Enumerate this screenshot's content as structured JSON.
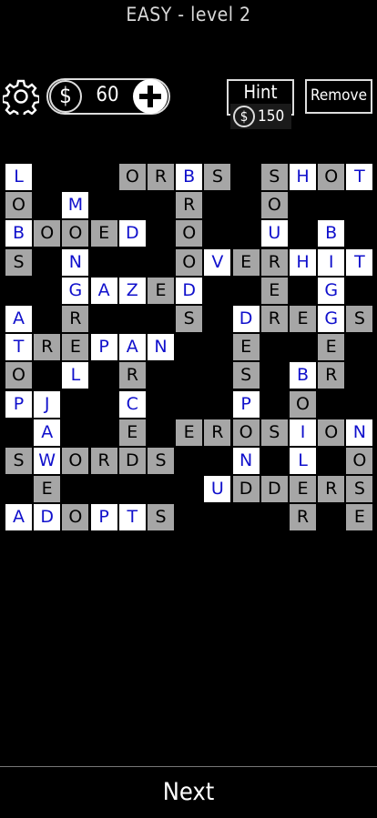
{
  "header": {
    "title": "EASY - level 2"
  },
  "toolbar": {
    "coin_symbol": "$",
    "coins": "60",
    "hint_label": "Hint",
    "hint_cost": "150",
    "remove_label": "Remove"
  },
  "footer": {
    "next_label": "Next"
  },
  "board": {
    "rows": [
      "LTTTOTRBSTTSHOT",
      "OTMTTTRTTTOTTTT",
      "BOOEDTTOTTUTTBT",
      "STNTTTTOVERHIT ",
      "TTGAZEDTTTETGTT",
      "ATRTTTSTTDREGS ",
      "TREPANTTTETTET ",
      "OTLTRTTTTSTBRTT",
      "PJTTCTTTTPTOTTT",
      "TATTETEROSION  ",
      "SWORDSTTTNTLTO ",
      "TETTTTTTUDDERS ",
      "ADOPTSTTTTTRTE "
    ],
    "cells": [
      {
        "r": 0,
        "c": 0,
        "ch": "L",
        "style": "w"
      },
      {
        "r": 0,
        "c": 4,
        "ch": "O",
        "style": "g"
      },
      {
        "r": 0,
        "c": 5,
        "ch": "R",
        "style": "g"
      },
      {
        "r": 0,
        "c": 6,
        "ch": "B",
        "style": "w"
      },
      {
        "r": 0,
        "c": 7,
        "ch": "S",
        "style": "g"
      },
      {
        "r": 0,
        "c": 9,
        "ch": "S",
        "style": "g"
      },
      {
        "r": 0,
        "c": 10,
        "ch": "H",
        "style": "w"
      },
      {
        "r": 0,
        "c": 11,
        "ch": "O",
        "style": "g"
      },
      {
        "r": 0,
        "c": 12,
        "ch": "T",
        "style": "w"
      },
      {
        "r": 1,
        "c": 0,
        "ch": "O",
        "style": "g"
      },
      {
        "r": 1,
        "c": 2,
        "ch": "M",
        "style": "w"
      },
      {
        "r": 1,
        "c": 6,
        "ch": "R",
        "style": "g"
      },
      {
        "r": 1,
        "c": 9,
        "ch": "O",
        "style": "g"
      },
      {
        "r": 2,
        "c": 0,
        "ch": "B",
        "style": "w"
      },
      {
        "r": 2,
        "c": 1,
        "ch": "O",
        "style": "g"
      },
      {
        "r": 2,
        "c": 2,
        "ch": "O",
        "style": "g"
      },
      {
        "r": 2,
        "c": 3,
        "ch": "E",
        "style": "g"
      },
      {
        "r": 2,
        "c": 4,
        "ch": "D",
        "style": "w"
      },
      {
        "r": 2,
        "c": 6,
        "ch": "O",
        "style": "g"
      },
      {
        "r": 2,
        "c": 9,
        "ch": "U",
        "style": "w"
      },
      {
        "r": 2,
        "c": 11,
        "ch": "B",
        "style": "w"
      },
      {
        "r": 3,
        "c": 0,
        "ch": "S",
        "style": "g"
      },
      {
        "r": 3,
        "c": 2,
        "ch": "N",
        "style": "w"
      },
      {
        "r": 3,
        "c": 6,
        "ch": "O",
        "style": "g"
      },
      {
        "r": 3,
        "c": 7,
        "ch": "V",
        "style": "w"
      },
      {
        "r": 3,
        "c": 8,
        "ch": "E",
        "style": "g"
      },
      {
        "r": 3,
        "c": 9,
        "ch": "R",
        "style": "g"
      },
      {
        "r": 3,
        "c": 10,
        "ch": "H",
        "style": "w"
      },
      {
        "r": 3,
        "c": 11,
        "ch": "I",
        "style": "w"
      },
      {
        "r": 3,
        "c": 12,
        "ch": "T",
        "style": "w"
      },
      {
        "r": 4,
        "c": 2,
        "ch": "G",
        "style": "w"
      },
      {
        "r": 4,
        "c": 3,
        "ch": "A",
        "style": "w"
      },
      {
        "r": 4,
        "c": 4,
        "ch": "Z",
        "style": "w"
      },
      {
        "r": 4,
        "c": 5,
        "ch": "E",
        "style": "g"
      },
      {
        "r": 4,
        "c": 6,
        "ch": "D",
        "style": "w"
      },
      {
        "r": 4,
        "c": 9,
        "ch": "E",
        "style": "g"
      },
      {
        "r": 4,
        "c": 11,
        "ch": "G",
        "style": "w"
      },
      {
        "r": 5,
        "c": 0,
        "ch": "A",
        "style": "w"
      },
      {
        "r": 5,
        "c": 2,
        "ch": "R",
        "style": "g"
      },
      {
        "r": 5,
        "c": 6,
        "ch": "S",
        "style": "g"
      },
      {
        "r": 5,
        "c": 8,
        "ch": "D",
        "style": "w"
      },
      {
        "r": 5,
        "c": 9,
        "ch": "R",
        "style": "g"
      },
      {
        "r": 5,
        "c": 10,
        "ch": "E",
        "style": "g"
      },
      {
        "r": 5,
        "c": 11,
        "ch": "G",
        "style": "w"
      },
      {
        "r": 5,
        "c": 12,
        "ch": "S",
        "style": "g"
      },
      {
        "r": 6,
        "c": 0,
        "ch": "T",
        "style": "w"
      },
      {
        "r": 6,
        "c": 1,
        "ch": "R",
        "style": "g"
      },
      {
        "r": 6,
        "c": 2,
        "ch": "E",
        "style": "g"
      },
      {
        "r": 6,
        "c": 3,
        "ch": "P",
        "style": "w"
      },
      {
        "r": 6,
        "c": 4,
        "ch": "A",
        "style": "w"
      },
      {
        "r": 6,
        "c": 5,
        "ch": "N",
        "style": "w"
      },
      {
        "r": 6,
        "c": 8,
        "ch": "E",
        "style": "g"
      },
      {
        "r": 6,
        "c": 11,
        "ch": "E",
        "style": "g"
      },
      {
        "r": 7,
        "c": 0,
        "ch": "O",
        "style": "g"
      },
      {
        "r": 7,
        "c": 2,
        "ch": "L",
        "style": "w"
      },
      {
        "r": 7,
        "c": 4,
        "ch": "R",
        "style": "g"
      },
      {
        "r": 7,
        "c": 8,
        "ch": "S",
        "style": "g"
      },
      {
        "r": 7,
        "c": 10,
        "ch": "B",
        "style": "w"
      },
      {
        "r": 7,
        "c": 11,
        "ch": "R",
        "style": "g"
      },
      {
        "r": 8,
        "c": 0,
        "ch": "P",
        "style": "w"
      },
      {
        "r": 8,
        "c": 1,
        "ch": "J",
        "style": "w"
      },
      {
        "r": 8,
        "c": 4,
        "ch": "C",
        "style": "w"
      },
      {
        "r": 8,
        "c": 8,
        "ch": "P",
        "style": "w"
      },
      {
        "r": 8,
        "c": 10,
        "ch": "O",
        "style": "g"
      },
      {
        "r": 9,
        "c": 1,
        "ch": "A",
        "style": "w"
      },
      {
        "r": 9,
        "c": 4,
        "ch": "E",
        "style": "g"
      },
      {
        "r": 9,
        "c": 6,
        "ch": "E",
        "style": "g"
      },
      {
        "r": 9,
        "c": 7,
        "ch": "R",
        "style": "g"
      },
      {
        "r": 9,
        "c": 8,
        "ch": "O",
        "style": "g"
      },
      {
        "r": 9,
        "c": 9,
        "ch": "S",
        "style": "g"
      },
      {
        "r": 9,
        "c": 10,
        "ch": "I",
        "style": "w"
      },
      {
        "r": 9,
        "c": 11,
        "ch": "O",
        "style": "g"
      },
      {
        "r": 9,
        "c": 12,
        "ch": "N",
        "style": "w"
      },
      {
        "r": 10,
        "c": 0,
        "ch": "S",
        "style": "g"
      },
      {
        "r": 10,
        "c": 1,
        "ch": "W",
        "style": "w"
      },
      {
        "r": 10,
        "c": 2,
        "ch": "O",
        "style": "g"
      },
      {
        "r": 10,
        "c": 3,
        "ch": "R",
        "style": "g"
      },
      {
        "r": 10,
        "c": 4,
        "ch": "D",
        "style": "g"
      },
      {
        "r": 10,
        "c": 5,
        "ch": "S",
        "style": "g"
      },
      {
        "r": 10,
        "c": 8,
        "ch": "N",
        "style": "w"
      },
      {
        "r": 10,
        "c": 10,
        "ch": "L",
        "style": "w"
      },
      {
        "r": 10,
        "c": 12,
        "ch": "O",
        "style": "g"
      },
      {
        "r": 11,
        "c": 1,
        "ch": "E",
        "style": "g"
      },
      {
        "r": 11,
        "c": 7,
        "ch": "U",
        "style": "w"
      },
      {
        "r": 11,
        "c": 8,
        "ch": "D",
        "style": "g"
      },
      {
        "r": 11,
        "c": 9,
        "ch": "D",
        "style": "g"
      },
      {
        "r": 11,
        "c": 10,
        "ch": "E",
        "style": "g"
      },
      {
        "r": 11,
        "c": 11,
        "ch": "R",
        "style": "g"
      },
      {
        "r": 11,
        "c": 12,
        "ch": "S",
        "style": "g"
      },
      {
        "r": 12,
        "c": 0,
        "ch": "A",
        "style": "w"
      },
      {
        "r": 12,
        "c": 1,
        "ch": "D",
        "style": "w"
      },
      {
        "r": 12,
        "c": 2,
        "ch": "O",
        "style": "g"
      },
      {
        "r": 12,
        "c": 3,
        "ch": "P",
        "style": "w"
      },
      {
        "r": 12,
        "c": 4,
        "ch": "T",
        "style": "w"
      },
      {
        "r": 12,
        "c": 5,
        "ch": "S",
        "style": "g"
      },
      {
        "r": 12,
        "c": 10,
        "ch": "R",
        "style": "g"
      },
      {
        "r": 12,
        "c": 12,
        "ch": "E",
        "style": "g"
      }
    ]
  }
}
